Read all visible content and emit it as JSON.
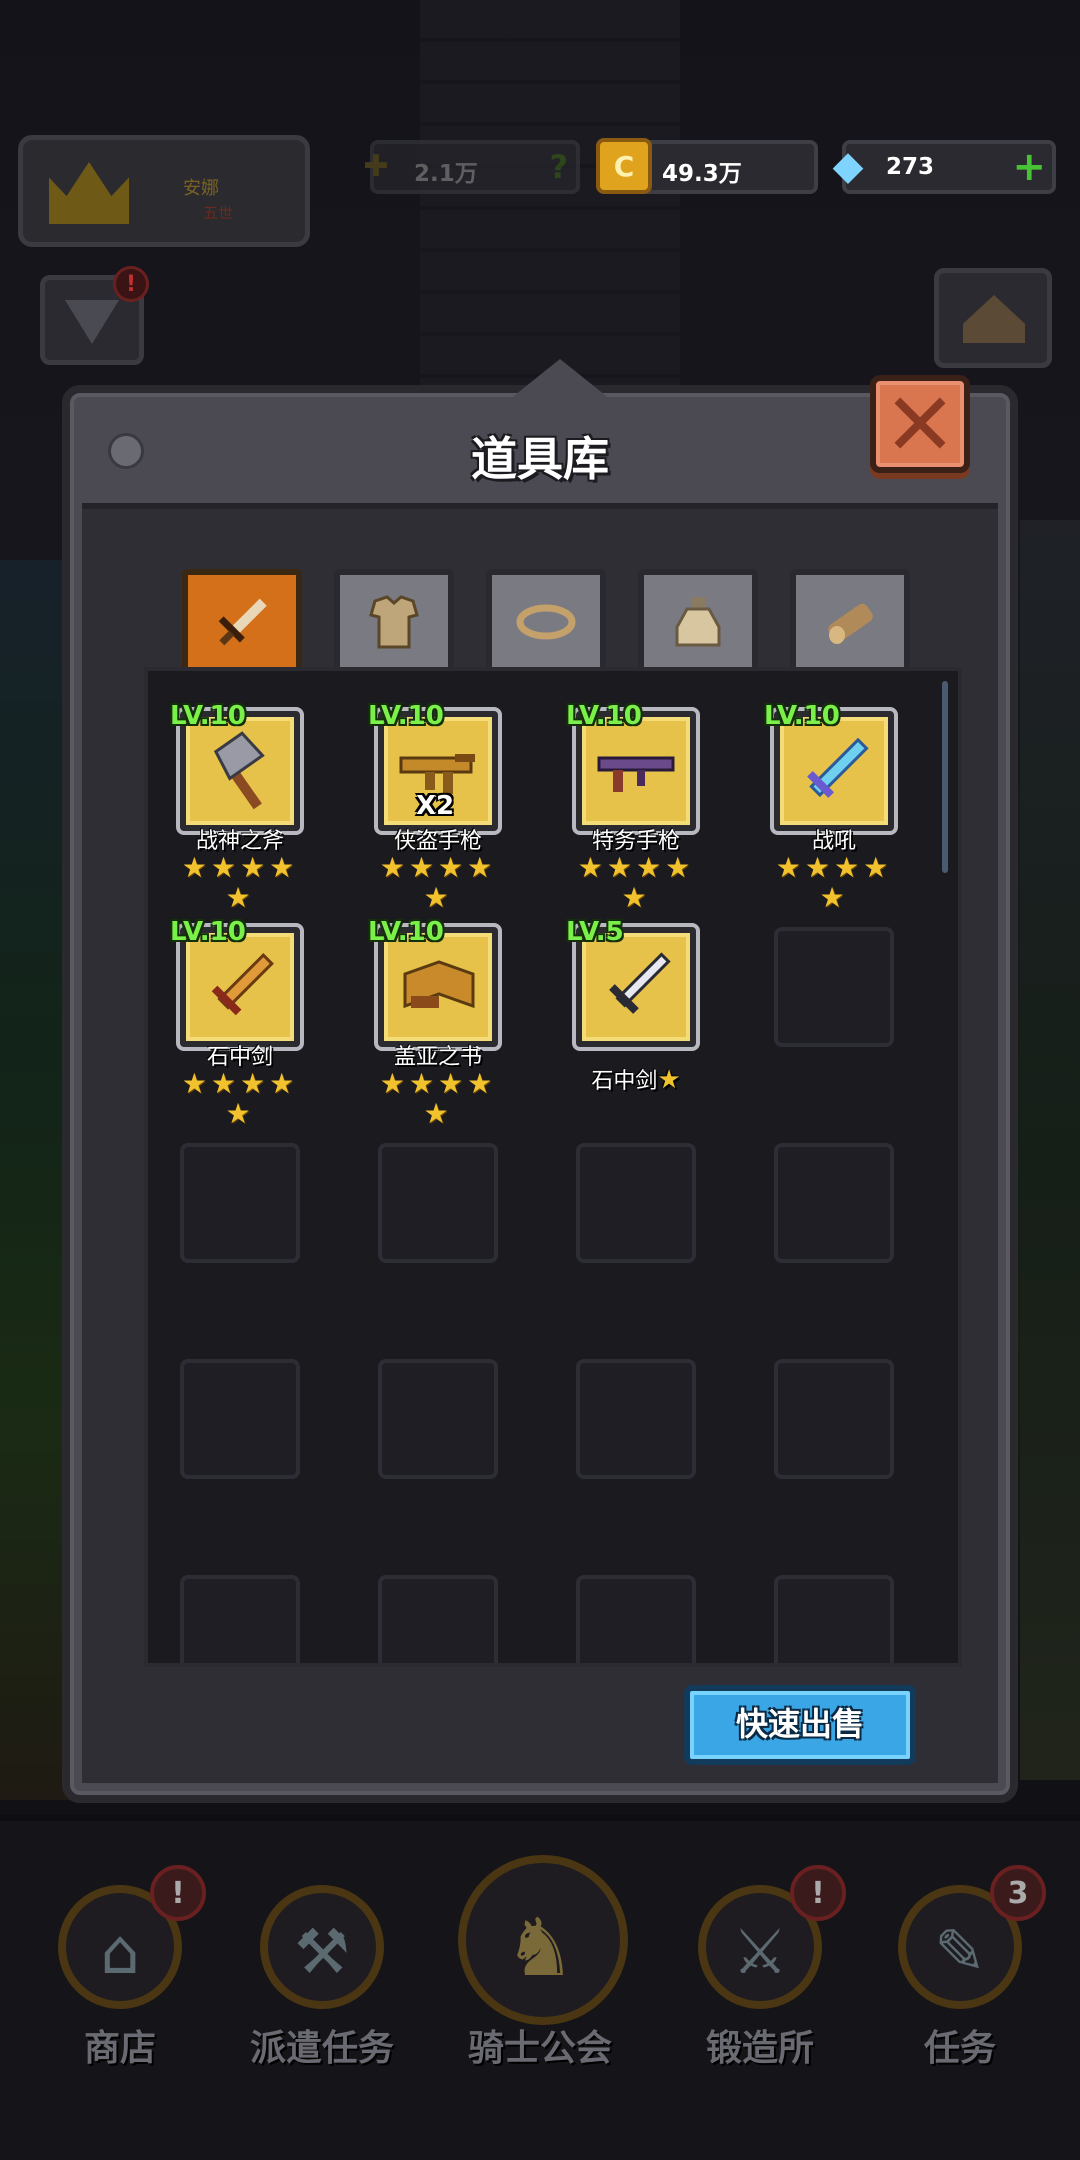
{
  "hud": {
    "player_name": "安娜",
    "player_sub": "五世",
    "power_value": "2.1万",
    "power_help": "?",
    "gold_value": "49.3万",
    "gold_symbol": "C",
    "gem_value": "273",
    "gem_plus": "+"
  },
  "panel": {
    "title": "道具库",
    "tabs": [
      {
        "name": "weapon",
        "icon": "sword-icon",
        "active": true
      },
      {
        "name": "armor",
        "icon": "armor-icon",
        "active": false
      },
      {
        "name": "ring",
        "icon": "ring-icon",
        "active": false
      },
      {
        "name": "potion",
        "icon": "potion-icon",
        "active": false
      },
      {
        "name": "material",
        "icon": "wood-log-icon",
        "active": false
      }
    ],
    "items": [
      {
        "level": "LV.10",
        "name": "战神之斧",
        "stars": "★★★★",
        "stars2": "★",
        "icon": "axe-icon",
        "count": ""
      },
      {
        "level": "LV.10",
        "name": "侠盗手枪",
        "stars": "★★★★",
        "stars2": "★",
        "icon": "rifle-icon",
        "count": "X2"
      },
      {
        "level": "LV.10",
        "name": "特务手枪",
        "stars": "★★★★",
        "stars2": "★",
        "icon": "smg-icon",
        "count": ""
      },
      {
        "level": "LV.10",
        "name": "战吼",
        "stars": "★★★★",
        "stars2": "★",
        "icon": "crystal-sword-icon",
        "count": ""
      },
      {
        "level": "LV.10",
        "name": "石中剑",
        "stars": "★★★★",
        "stars2": "★",
        "icon": "golden-sword-icon",
        "count": ""
      },
      {
        "level": "LV.10",
        "name": "盖亚之书",
        "stars": "★★★★",
        "stars2": "★",
        "icon": "book-icon",
        "count": ""
      },
      {
        "level": "LV.5",
        "name": "石中剑",
        "stars": "★",
        "stars2": "",
        "icon": "steel-sword-icon",
        "count": ""
      }
    ],
    "sell_label": "快速出售"
  },
  "nav": [
    {
      "label": "商店",
      "icon": "shop-icon",
      "badge": "!"
    },
    {
      "label": "派遣任务",
      "icon": "dispatch-icon",
      "badge": ""
    },
    {
      "label": "骑士公会",
      "icon": "knight-helmet-icon",
      "badge": ""
    },
    {
      "label": "锻造所",
      "icon": "anvil-hammer-icon",
      "badge": "!"
    },
    {
      "label": "任务",
      "icon": "quest-scroll-icon",
      "badge": "3"
    }
  ],
  "colors": {
    "accent_orange": "#d5701a",
    "gold_frame": "#e6c24a",
    "level_green": "#7cf04a",
    "star_yellow": "#f2c12e",
    "sell_blue": "#3aa6e6",
    "close_red": "#d9754f"
  }
}
